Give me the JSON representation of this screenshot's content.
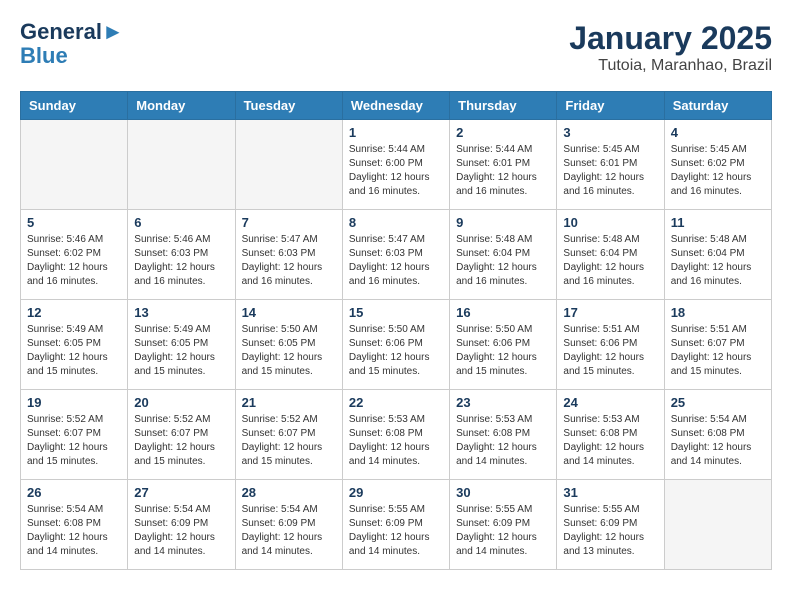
{
  "header": {
    "logo_line1": "General",
    "logo_line2": "Blue",
    "month": "January 2025",
    "location": "Tutoia, Maranhao, Brazil"
  },
  "weekdays": [
    "Sunday",
    "Monday",
    "Tuesday",
    "Wednesday",
    "Thursday",
    "Friday",
    "Saturday"
  ],
  "weeks": [
    [
      {
        "day": "",
        "info": ""
      },
      {
        "day": "",
        "info": ""
      },
      {
        "day": "",
        "info": ""
      },
      {
        "day": "1",
        "info": "Sunrise: 5:44 AM\nSunset: 6:00 PM\nDaylight: 12 hours\nand 16 minutes."
      },
      {
        "day": "2",
        "info": "Sunrise: 5:44 AM\nSunset: 6:01 PM\nDaylight: 12 hours\nand 16 minutes."
      },
      {
        "day": "3",
        "info": "Sunrise: 5:45 AM\nSunset: 6:01 PM\nDaylight: 12 hours\nand 16 minutes."
      },
      {
        "day": "4",
        "info": "Sunrise: 5:45 AM\nSunset: 6:02 PM\nDaylight: 12 hours\nand 16 minutes."
      }
    ],
    [
      {
        "day": "5",
        "info": "Sunrise: 5:46 AM\nSunset: 6:02 PM\nDaylight: 12 hours\nand 16 minutes."
      },
      {
        "day": "6",
        "info": "Sunrise: 5:46 AM\nSunset: 6:03 PM\nDaylight: 12 hours\nand 16 minutes."
      },
      {
        "day": "7",
        "info": "Sunrise: 5:47 AM\nSunset: 6:03 PM\nDaylight: 12 hours\nand 16 minutes."
      },
      {
        "day": "8",
        "info": "Sunrise: 5:47 AM\nSunset: 6:03 PM\nDaylight: 12 hours\nand 16 minutes."
      },
      {
        "day": "9",
        "info": "Sunrise: 5:48 AM\nSunset: 6:04 PM\nDaylight: 12 hours\nand 16 minutes."
      },
      {
        "day": "10",
        "info": "Sunrise: 5:48 AM\nSunset: 6:04 PM\nDaylight: 12 hours\nand 16 minutes."
      },
      {
        "day": "11",
        "info": "Sunrise: 5:48 AM\nSunset: 6:04 PM\nDaylight: 12 hours\nand 16 minutes."
      }
    ],
    [
      {
        "day": "12",
        "info": "Sunrise: 5:49 AM\nSunset: 6:05 PM\nDaylight: 12 hours\nand 15 minutes."
      },
      {
        "day": "13",
        "info": "Sunrise: 5:49 AM\nSunset: 6:05 PM\nDaylight: 12 hours\nand 15 minutes."
      },
      {
        "day": "14",
        "info": "Sunrise: 5:50 AM\nSunset: 6:05 PM\nDaylight: 12 hours\nand 15 minutes."
      },
      {
        "day": "15",
        "info": "Sunrise: 5:50 AM\nSunset: 6:06 PM\nDaylight: 12 hours\nand 15 minutes."
      },
      {
        "day": "16",
        "info": "Sunrise: 5:50 AM\nSunset: 6:06 PM\nDaylight: 12 hours\nand 15 minutes."
      },
      {
        "day": "17",
        "info": "Sunrise: 5:51 AM\nSunset: 6:06 PM\nDaylight: 12 hours\nand 15 minutes."
      },
      {
        "day": "18",
        "info": "Sunrise: 5:51 AM\nSunset: 6:07 PM\nDaylight: 12 hours\nand 15 minutes."
      }
    ],
    [
      {
        "day": "19",
        "info": "Sunrise: 5:52 AM\nSunset: 6:07 PM\nDaylight: 12 hours\nand 15 minutes."
      },
      {
        "day": "20",
        "info": "Sunrise: 5:52 AM\nSunset: 6:07 PM\nDaylight: 12 hours\nand 15 minutes."
      },
      {
        "day": "21",
        "info": "Sunrise: 5:52 AM\nSunset: 6:07 PM\nDaylight: 12 hours\nand 15 minutes."
      },
      {
        "day": "22",
        "info": "Sunrise: 5:53 AM\nSunset: 6:08 PM\nDaylight: 12 hours\nand 14 minutes."
      },
      {
        "day": "23",
        "info": "Sunrise: 5:53 AM\nSunset: 6:08 PM\nDaylight: 12 hours\nand 14 minutes."
      },
      {
        "day": "24",
        "info": "Sunrise: 5:53 AM\nSunset: 6:08 PM\nDaylight: 12 hours\nand 14 minutes."
      },
      {
        "day": "25",
        "info": "Sunrise: 5:54 AM\nSunset: 6:08 PM\nDaylight: 12 hours\nand 14 minutes."
      }
    ],
    [
      {
        "day": "26",
        "info": "Sunrise: 5:54 AM\nSunset: 6:08 PM\nDaylight: 12 hours\nand 14 minutes."
      },
      {
        "day": "27",
        "info": "Sunrise: 5:54 AM\nSunset: 6:09 PM\nDaylight: 12 hours\nand 14 minutes."
      },
      {
        "day": "28",
        "info": "Sunrise: 5:54 AM\nSunset: 6:09 PM\nDaylight: 12 hours\nand 14 minutes."
      },
      {
        "day": "29",
        "info": "Sunrise: 5:55 AM\nSunset: 6:09 PM\nDaylight: 12 hours\nand 14 minutes."
      },
      {
        "day": "30",
        "info": "Sunrise: 5:55 AM\nSunset: 6:09 PM\nDaylight: 12 hours\nand 14 minutes."
      },
      {
        "day": "31",
        "info": "Sunrise: 5:55 AM\nSunset: 6:09 PM\nDaylight: 12 hours\nand 13 minutes."
      },
      {
        "day": "",
        "info": ""
      }
    ]
  ]
}
